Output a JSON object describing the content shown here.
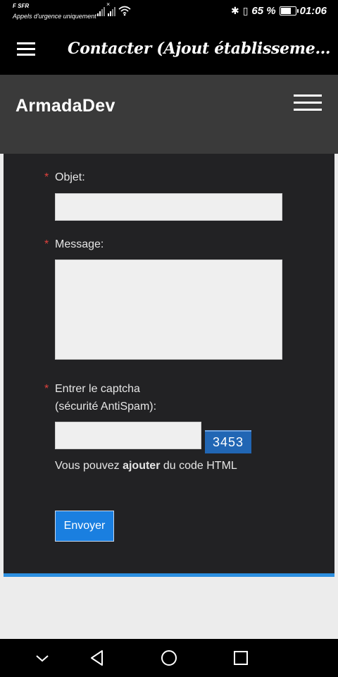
{
  "status_bar": {
    "carrier": "F SFR",
    "carrier_sub": "Appels d'urgence uniquement",
    "battery_text": "65 %",
    "battery_level": 0.65,
    "time": "01:06"
  },
  "app_bar": {
    "title": "Contacter (Ajout établissement ou av..."
  },
  "site_header": {
    "brand": "ArmadaDev"
  },
  "form": {
    "required_mark": "*",
    "subject_label": "Objet:",
    "subject_value": "",
    "message_label": "Message:",
    "message_value": "",
    "captcha_label_line1": "Entrer le captcha",
    "captcha_label_line2": "(sécurité AntiSpam):",
    "captcha_value": "",
    "captcha_code": "3453",
    "hint_before": "Vous pouvez ",
    "hint_bold": "ajouter",
    "hint_after": " du code HTML",
    "submit_label": "Envoyer"
  },
  "colors": {
    "panel": "#222224",
    "header": "#3a3a3a",
    "accent": "#1a7fe0",
    "required": "#e0413c"
  }
}
